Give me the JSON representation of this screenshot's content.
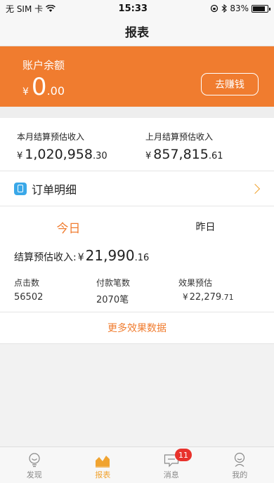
{
  "status_bar": {
    "carrier": "无 SIM 卡",
    "time": "15:33",
    "battery": "83%",
    "battery_level": 0.83
  },
  "nav": {
    "title": "报表"
  },
  "balance": {
    "label": "账户余额",
    "currency": "¥",
    "integer": "0",
    "decimal": ".00",
    "earn_button": "去赚钱"
  },
  "estimates": [
    {
      "label": "本月结算预估收入",
      "currency": "¥",
      "integer": "1,020,958",
      "decimal": ".30"
    },
    {
      "label": "上月结算预估收入",
      "currency": "¥",
      "integer": "857,815",
      "decimal": ".61"
    }
  ],
  "orders": {
    "label": "订单明细"
  },
  "stats": {
    "tabs": [
      {
        "label": "今日",
        "active": true
      },
      {
        "label": "昨日",
        "active": false
      }
    ],
    "settle_label": "结算预估收入:",
    "settle_currency": "¥",
    "settle_integer": "21,990",
    "settle_decimal": ".16",
    "metrics": [
      {
        "label": "点击数",
        "value": "56502"
      },
      {
        "label": "付款笔数",
        "value": "2070笔"
      },
      {
        "label": "效果预估",
        "currency": "¥",
        "integer": "22,279",
        "decimal": ".71"
      }
    ],
    "more_link": "更多效果数据"
  },
  "tab_bar": {
    "items": [
      {
        "label": "发现",
        "icon": "bulb-icon"
      },
      {
        "label": "报表",
        "icon": "chart-icon"
      },
      {
        "label": "消息",
        "icon": "message-icon",
        "badge": "11"
      },
      {
        "label": "我的",
        "icon": "user-icon"
      }
    ]
  },
  "colors": {
    "accent": "#f07c2f",
    "tab_active": "#f0a330",
    "badge": "#e8322c",
    "orders_icon": "#3aa8e8"
  }
}
